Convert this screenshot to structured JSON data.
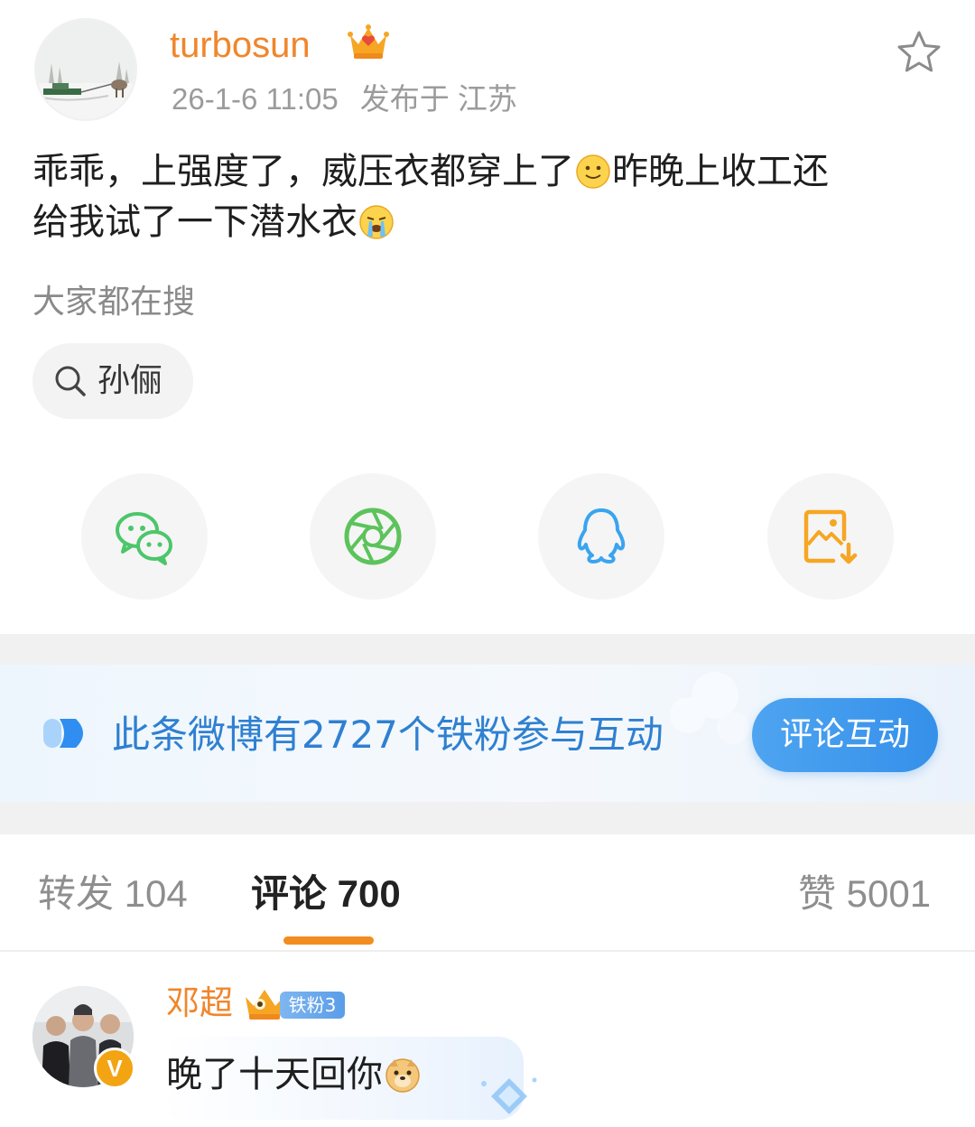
{
  "post": {
    "username": "turbosun",
    "timestamp": "26-1-6 11:05",
    "location": "发布于 江苏",
    "text_line1": "乖乖，上强度了，威压衣都穿上了",
    "text_line1_after_emoji": "昨晚上收工还",
    "text_line2": "给我试了一下潜水衣",
    "emoji_1": "smile-emoji",
    "emoji_2": "crying-emoji"
  },
  "hot_search": {
    "label": "大家都在搜",
    "chip_text": "孙俪"
  },
  "share": {
    "items": [
      {
        "name": "wechat",
        "icon": "wechat-icon",
        "color": "#4cc66b"
      },
      {
        "name": "moments",
        "icon": "moments-shutter-icon",
        "color": "#5cc35b"
      },
      {
        "name": "qq",
        "icon": "qq-penguin-icon",
        "color": "#3aa4ef"
      },
      {
        "name": "save-image",
        "icon": "save-image-icon",
        "color": "#f5a623"
      }
    ]
  },
  "fan_banner": {
    "text": "此条微博有2727个铁粉参与互动",
    "button": "评论互动"
  },
  "tabs": {
    "repost": "转发 104",
    "comment": "评论 700",
    "like": "赞 5001"
  },
  "comment": {
    "username": "邓超",
    "fan_badge": "铁粉3",
    "text": "晚了十天回你",
    "emoji": "doge-emoji",
    "verify_mark": "V"
  },
  "colors": {
    "username": "#f0862b",
    "link_blue": "#2f80d1",
    "button_blue": "#3590ea",
    "tab_underline": "#f28c1e"
  }
}
